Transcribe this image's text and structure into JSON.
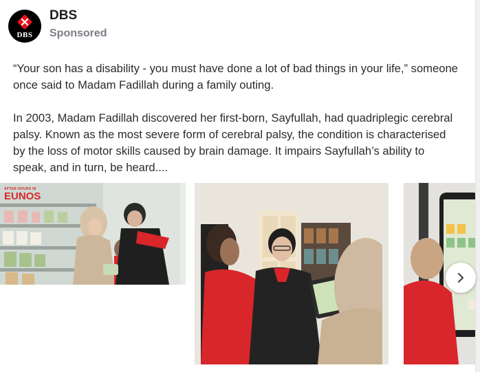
{
  "post": {
    "page_name": "DBS",
    "sponsored_label": "Sponsored",
    "logo_text": "DBS",
    "paragraphs": [
      "“Your son has a disability - you must have done a lot of bad things in your life,” someone once said to Madam Fadillah during a family outing.",
      "In 2003, Madam Fadillah discovered her first-born, Sayfullah, had quadriplegic cerebral palsy. Known as the most severe form of cerebral palsy, the condition is characterised by the loss of motor skills caused by brain damage. It impairs Sayfullah’s ability to speak, and in turn, be heard...."
    ]
  },
  "carousel": {
    "slide1_badge_top": "AFTER HOURS IN",
    "slide1_badge_title": "EUNOS",
    "next_icon": "chevron-right-icon"
  },
  "colors": {
    "brand_red": "#e4131c",
    "shirt_red": "#d8262b"
  }
}
